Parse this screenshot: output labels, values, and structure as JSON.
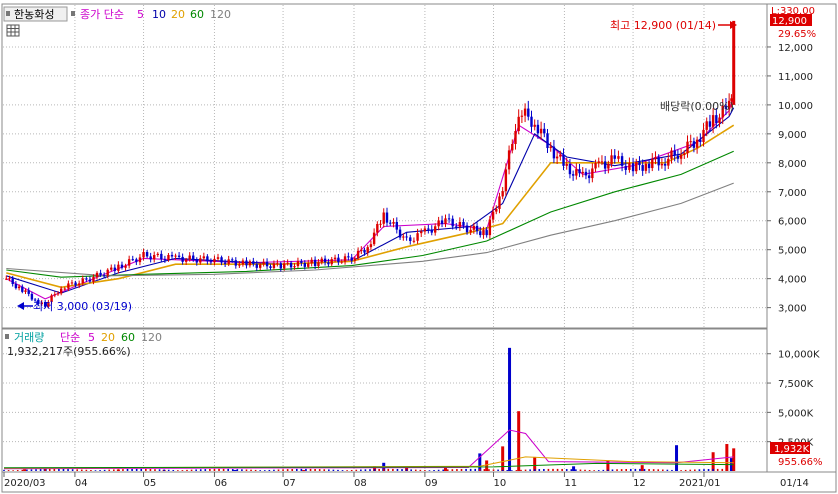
{
  "header": {
    "stock_name": "한농화성",
    "indicator_label": "종가 단순",
    "ma_periods": [
      "5",
      "10",
      "20",
      "60",
      "120"
    ],
    "ma_colors": [
      "#cc00cc",
      "#0000aa",
      "#e0a000",
      "#008800",
      "#808080"
    ],
    "grid_icon": "grid-icon"
  },
  "volume_header": {
    "label": "거래량",
    "indicator_label": "단순",
    "ma_periods": [
      "5",
      "20",
      "60",
      "120"
    ],
    "ma_colors": [
      "#cc00cc",
      "#e0a000",
      "#008800",
      "#808080"
    ],
    "current_text": "1,932,217주(955.66%)"
  },
  "annotations": {
    "high_label": "최고 12,900 (01/14)",
    "low_label": "최저 3,000 (03/19)",
    "ex_dividend_label": "배당락(0.00%)"
  },
  "price_axis": {
    "top_label": "L:330.00",
    "ticks": [
      "12,000",
      "11,000",
      "10,000",
      "9,000",
      "8,000",
      "7,000",
      "6,000",
      "5,000",
      "4,000",
      "3,000"
    ],
    "current_price": "12,900",
    "current_change": "29.65%"
  },
  "volume_axis": {
    "ticks": [
      "10,000K",
      "7,500K",
      "5,000K",
      "2,500K"
    ],
    "current_volume": "1,932K",
    "current_ratio": "955.66%"
  },
  "x_axis": {
    "labels": [
      "2020/03",
      "04",
      "05",
      "06",
      "07",
      "08",
      "09",
      "10",
      "11",
      "12",
      "2021/01",
      "01/14"
    ]
  },
  "colors": {
    "up": "#dd0000",
    "down": "#0000cc",
    "grid": "#b8b8b8",
    "background": "#ffffff",
    "current_box": "#dd0000"
  },
  "chart_data": {
    "type": "candlestick",
    "title": "한농화성",
    "price_ylim": [
      2400,
      13000
    ],
    "volume_ylim": [
      0,
      11000
    ],
    "volume_unit": "K",
    "x_range": [
      "2020/03",
      "2021/01/14"
    ],
    "close_series": [
      [
        "2020/03/02",
        4000
      ],
      [
        "2020/03/09",
        3600
      ],
      [
        "2020/03/16",
        3200
      ],
      [
        "2020/03/19",
        3100
      ],
      [
        "2020/03/26",
        3700
      ],
      [
        "2020/04/06",
        3950
      ],
      [
        "2020/04/20",
        4400
      ],
      [
        "2020/05/01",
        4800
      ],
      [
        "2020/05/15",
        4700
      ],
      [
        "2020/06/01",
        4650
      ],
      [
        "2020/06/15",
        4500
      ],
      [
        "2020/06/30",
        4450
      ],
      [
        "2020/07/15",
        4550
      ],
      [
        "2020/07/31",
        4700
      ],
      [
        "2020/08/07",
        5100
      ],
      [
        "2020/08/14",
        6200
      ],
      [
        "2020/08/24",
        5300
      ],
      [
        "2020/09/01",
        5600
      ],
      [
        "2020/09/10",
        6000
      ],
      [
        "2020/09/21",
        5700
      ],
      [
        "2020/09/28",
        5600
      ],
      [
        "2020/10/05",
        7200
      ],
      [
        "2020/10/12",
        9800
      ],
      [
        "2020/10/19",
        9400
      ],
      [
        "2020/10/26",
        8500
      ],
      [
        "2020/11/02",
        7800
      ],
      [
        "2020/11/09",
        7500
      ],
      [
        "2020/11/16",
        7900
      ],
      [
        "2020/11/23",
        8100
      ],
      [
        "2020/12/01",
        7800
      ],
      [
        "2020/12/08",
        8000
      ],
      [
        "2020/12/15",
        8100
      ],
      [
        "2020/12/22",
        8400
      ],
      [
        "2020/12/29",
        8800
      ],
      [
        "2021/01/05",
        9500
      ],
      [
        "2021/01/12",
        9900
      ],
      [
        "2021/01/13",
        10000
      ],
      [
        "2021/01/14",
        12900
      ]
    ],
    "ma_lines": [
      {
        "name": "5",
        "values": [
          [
            "2020/03/02",
            4000
          ],
          [
            "2020/03/19",
            3300
          ],
          [
            "2020/04/06",
            3900
          ],
          [
            "2020/05/01",
            4700
          ],
          [
            "2020/06/15",
            4550
          ],
          [
            "2020/07/31",
            4650
          ],
          [
            "2020/08/14",
            5800
          ],
          [
            "2020/09/10",
            5900
          ],
          [
            "2020/09/28",
            5700
          ],
          [
            "2020/10/12",
            9300
          ],
          [
            "2020/10/26",
            8600
          ],
          [
            "2020/11/09",
            7600
          ],
          [
            "2020/12/01",
            7900
          ],
          [
            "2020/12/29",
            8700
          ],
          [
            "2021/01/12",
            9800
          ],
          [
            "2021/01/14",
            10300
          ]
        ]
      },
      {
        "name": "10",
        "values": [
          [
            "2020/03/02",
            4100
          ],
          [
            "2020/03/26",
            3500
          ],
          [
            "2020/04/20",
            4200
          ],
          [
            "2020/05/15",
            4700
          ],
          [
            "2020/06/30",
            4500
          ],
          [
            "2020/07/31",
            4600
          ],
          [
            "2020/08/24",
            5600
          ],
          [
            "2020/09/21",
            5800
          ],
          [
            "2020/10/05",
            6600
          ],
          [
            "2020/10/19",
            9000
          ],
          [
            "2020/11/02",
            8200
          ],
          [
            "2020/11/23",
            7900
          ],
          [
            "2020/12/22",
            8300
          ],
          [
            "2021/01/12",
            9600
          ],
          [
            "2021/01/14",
            9900
          ]
        ]
      },
      {
        "name": "20",
        "values": [
          [
            "2020/03/02",
            4200
          ],
          [
            "2020/03/26",
            3700
          ],
          [
            "2020/04/20",
            4000
          ],
          [
            "2020/05/15",
            4500
          ],
          [
            "2020/06/30",
            4500
          ],
          [
            "2020/07/31",
            4600
          ],
          [
            "2020/08/24",
            5100
          ],
          [
            "2020/09/21",
            5600
          ],
          [
            "2020/10/05",
            5900
          ],
          [
            "2020/10/26",
            8000
          ],
          [
            "2020/11/16",
            8000
          ],
          [
            "2020/12/15",
            8000
          ],
          [
            "2020/12/29",
            8500
          ],
          [
            "2021/01/14",
            9300
          ]
        ]
      },
      {
        "name": "60",
        "values": [
          [
            "2020/03/02",
            4300
          ],
          [
            "2020/03/26",
            4050
          ],
          [
            "2020/05/01",
            4150
          ],
          [
            "2020/06/15",
            4250
          ],
          [
            "2020/07/31",
            4450
          ],
          [
            "2020/08/31",
            4800
          ],
          [
            "2020/09/28",
            5300
          ],
          [
            "2020/10/26",
            6300
          ],
          [
            "2020/11/23",
            7000
          ],
          [
            "2020/12/22",
            7600
          ],
          [
            "2021/01/14",
            8400
          ]
        ]
      },
      {
        "name": "120",
        "values": [
          [
            "2020/03/02",
            4350
          ],
          [
            "2020/04/15",
            4100
          ],
          [
            "2020/06/01",
            4150
          ],
          [
            "2020/07/15",
            4300
          ],
          [
            "2020/08/31",
            4600
          ],
          [
            "2020/09/28",
            4900
          ],
          [
            "2020/10/26",
            5500
          ],
          [
            "2020/11/23",
            6000
          ],
          [
            "2020/12/22",
            6600
          ],
          [
            "2021/01/14",
            7300
          ]
        ]
      }
    ],
    "volume_series": [
      [
        "2020/03/10",
        150
      ],
      [
        "2020/03/19",
        250
      ],
      [
        "2020/04/20",
        120
      ],
      [
        "2020/05/10",
        100
      ],
      [
        "2020/06/10",
        90
      ],
      [
        "2020/07/10",
        80
      ],
      [
        "2020/08/10",
        400
      ],
      [
        "2020/08/14",
        700
      ],
      [
        "2020/08/24",
        300
      ],
      [
        "2020/09/10",
        400
      ],
      [
        "2020/09/25",
        1500
      ],
      [
        "2020/09/28",
        900
      ],
      [
        "2020/10/05",
        2100
      ],
      [
        "2020/10/08",
        10500
      ],
      [
        "2020/10/12",
        5100
      ],
      [
        "2020/10/19",
        1200
      ],
      [
        "2020/11/05",
        400
      ],
      [
        "2020/11/20",
        900
      ],
      [
        "2020/12/05",
        500
      ],
      [
        "2020/12/20",
        2200
      ],
      [
        "2021/01/05",
        1600
      ],
      [
        "2021/01/11",
        2300
      ],
      [
        "2021/01/13",
        1100
      ],
      [
        "2021/01/14",
        1932
      ]
    ]
  }
}
